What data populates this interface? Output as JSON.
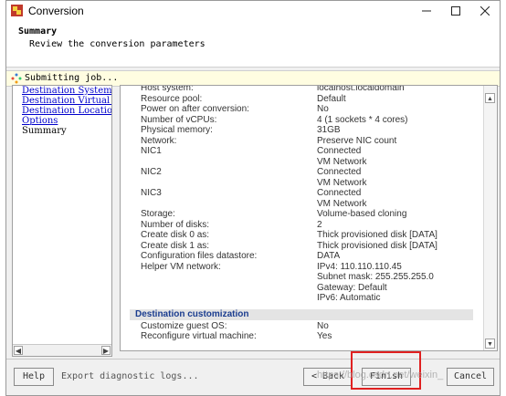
{
  "window": {
    "title": "Conversion"
  },
  "header": {
    "title": "Summary",
    "subtitle": "Review the conversion parameters"
  },
  "status": {
    "text": "Submitting job..."
  },
  "nav": {
    "items": [
      {
        "label": "Destination System",
        "link": true
      },
      {
        "label": "Destination Virtual M",
        "link": true
      },
      {
        "label": "Destination Location",
        "link": true
      },
      {
        "label": "Options",
        "link": true
      },
      {
        "label": "Summary",
        "link": false
      }
    ]
  },
  "summary": {
    "rows": [
      {
        "k": "Host system:",
        "v": "localhost.localdomain"
      },
      {
        "k": "Resource pool:",
        "v": "Default"
      },
      {
        "k": "Power on after conversion:",
        "v": "No"
      },
      {
        "k": "Number of vCPUs:",
        "v": "4 (1 sockets * 4 cores)"
      },
      {
        "k": "Physical memory:",
        "v": "31GB"
      },
      {
        "k": "Network:",
        "v": "Preserve NIC count"
      },
      {
        "k": "NIC1",
        "v": "Connected"
      },
      {
        "k": "",
        "v": "VM Network"
      },
      {
        "k": "NIC2",
        "v": "Connected"
      },
      {
        "k": "",
        "v": "VM Network"
      },
      {
        "k": "NIC3",
        "v": "Connected"
      },
      {
        "k": "",
        "v": "VM Network"
      },
      {
        "k": "Storage:",
        "v": "Volume-based cloning"
      },
      {
        "k": "Number of disks:",
        "v": "2"
      },
      {
        "k": "Create disk 0 as:",
        "v": "Thick provisioned disk [DATA]"
      },
      {
        "k": "Create disk 1 as:",
        "v": "Thick provisioned disk [DATA]"
      },
      {
        "k": "Configuration files datastore:",
        "v": "DATA"
      },
      {
        "k": "Helper VM network:",
        "v": "IPv4: 110.110.110.45"
      },
      {
        "k": "",
        "v": "Subnet mask: 255.255.255.0"
      },
      {
        "k": "",
        "v": "Gateway: Default"
      },
      {
        "k": "",
        "v": "IPv6: Automatic"
      }
    ],
    "section": "Destination customization",
    "rows2": [
      {
        "k": "Customize guest OS:",
        "v": "No"
      },
      {
        "k": "Reconfigure virtual machine:",
        "v": "Yes"
      }
    ]
  },
  "footer": {
    "help": "Help",
    "export": "Export diagnostic logs...",
    "back": "< Back",
    "finish": "Finish",
    "cancel": "Cancel"
  },
  "watermark": "https://blog.csdn.net/weixin_"
}
